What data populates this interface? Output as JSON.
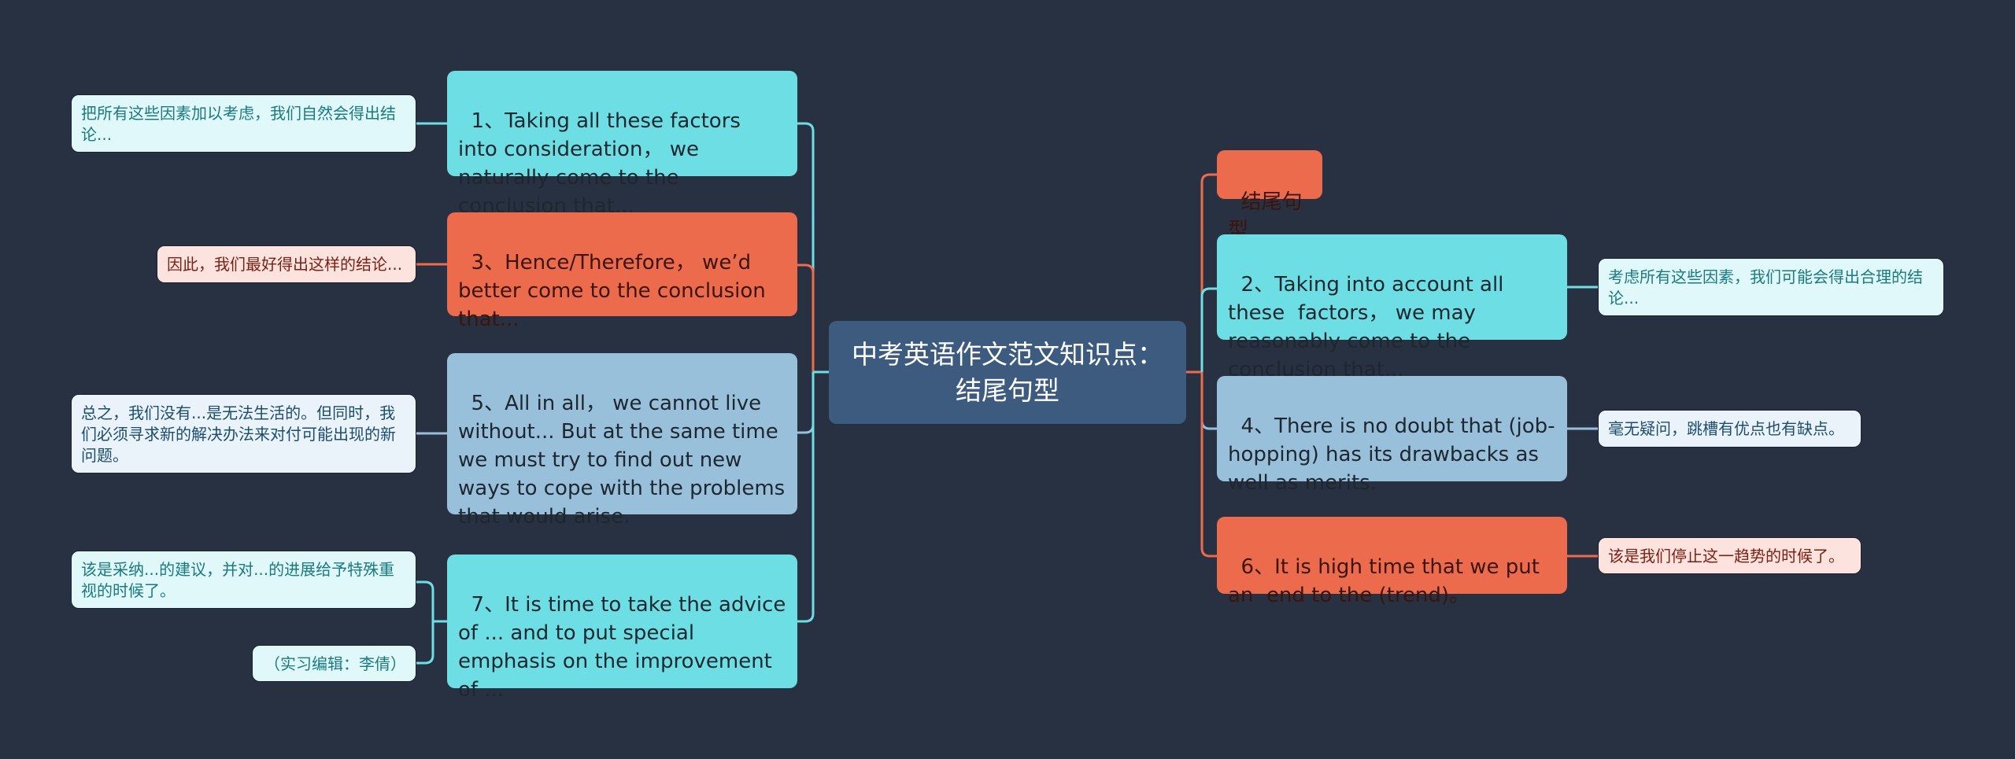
{
  "root": {
    "title": "中考英语作文范文知识点：结尾句型"
  },
  "left_branches": [
    {
      "label": "1、Taking all these factors into consideration， we naturally come to the conclusion that...",
      "color": "cyan",
      "notes": [
        "把所有这些因素加以考虑，我们自然会得出结论..."
      ]
    },
    {
      "label": "3、Hence/Therefore， we’d better come to the conclusion that...",
      "color": "orange",
      "notes": [
        "因此，我们最好得出这样的结论..."
      ]
    },
    {
      "label": "5、All in all， we cannot live without... But at the same time we must try to find out new ways to cope with the problems  that would arise.",
      "color": "blue",
      "notes": [
        "总之，我们没有...是无法生活的。但同时，我们必须寻求新的解决办法来对付可能出现的新问题。"
      ]
    },
    {
      "label": "7、It is time to take the advice of ... and to put special emphasis on the improvement of ...",
      "color": "cyan",
      "notes": [
        "该是采纳...的建议，并对...的进展给予特殊重视的时候了。",
        "（实习编辑：李倩）"
      ]
    }
  ],
  "right_branches": [
    {
      "label": "结尾句型",
      "color": "orange",
      "notes": []
    },
    {
      "label": "2、Taking into account all these  factors， we may reasonably come to the conclusion that...",
      "color": "cyan",
      "notes": [
        "考虑所有这些因素，我们可能会得出合理的结论..."
      ]
    },
    {
      "label": "4、There is no doubt that (job-hopping) has its drawbacks as well as merits.",
      "color": "blue",
      "notes": [
        "毫无疑问，跳槽有优点也有缺点。"
      ]
    },
    {
      "label": "6、It is high time that we put an  end to the (trend)。",
      "color": "orange",
      "notes": [
        "该是我们停止这一趋势的时候了。"
      ]
    }
  ],
  "colors": {
    "background": "#283141",
    "root": "#3d5b7f",
    "cyan": "#6ddfe4",
    "orange": "#ec6b4d",
    "blue": "#98c0da"
  }
}
